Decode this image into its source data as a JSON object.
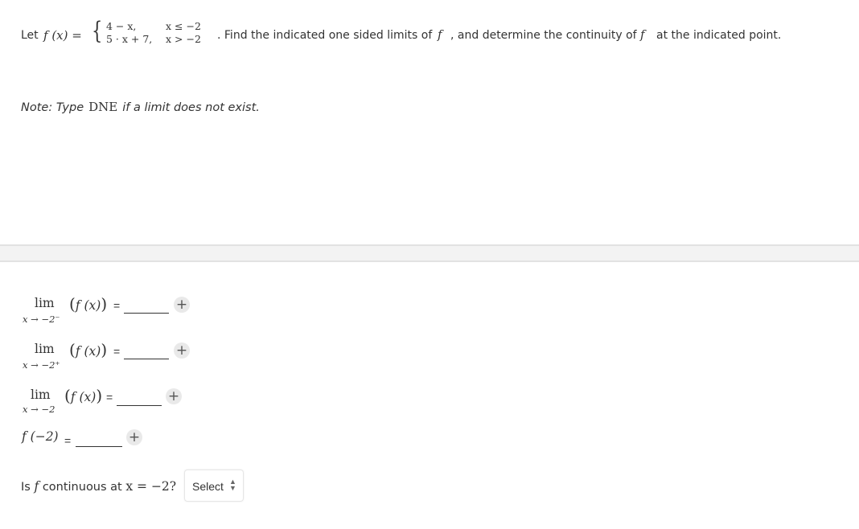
{
  "problem": {
    "let": "Let",
    "function_lhs": "f (x) =",
    "pieces": [
      {
        "expr": "4 − x,",
        "cond": "x ≤ −2"
      },
      {
        "expr": "5 · x + 7,",
        "cond": "x > −2"
      }
    ],
    "instruction": ". Find the indicated one sided limits of",
    "f1": "f",
    "instruction2": ", and determine the continuity of",
    "f2": "f",
    "instruction3": "at the indicated point."
  },
  "note": {
    "prefix": "Note: Type",
    "dne": "DNE",
    "suffix": "if a limit does not exist."
  },
  "limits": [
    {
      "lim": "lim",
      "sub": "x → −2⁻",
      "expr": "f (x)",
      "equals": "="
    },
    {
      "lim": "lim",
      "sub": "x → −2⁺",
      "expr": "f (x)",
      "equals": "="
    },
    {
      "lim": "lim",
      "sub": "x → −2",
      "expr": "f (x)",
      "equals": "="
    }
  ],
  "value": {
    "expr": "f (−2)",
    "equals": "="
  },
  "plus_label": "+",
  "continuity": {
    "prefix": "Is",
    "f": "f",
    "middle": "continuous at",
    "point": "x = −2?",
    "select_label": "Select"
  }
}
